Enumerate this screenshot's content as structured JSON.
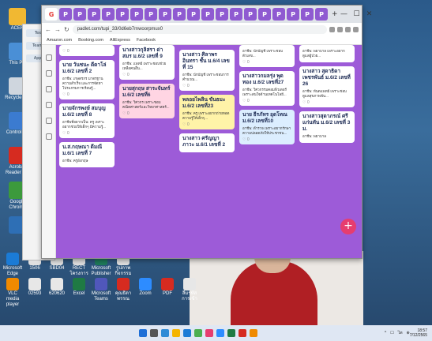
{
  "desktop": {
    "icons_left": [
      {
        "label": "ACER",
        "color": "#f1b832"
      },
      {
        "label": "This PC",
        "color": "#4a8fd6"
      },
      {
        "label": "Recycle Bin",
        "color": "#cfd6de"
      },
      {
        "label": "Control Pa",
        "color": "#3b7bd0"
      },
      {
        "label": "Acrobat Reader DC",
        "color": "#d62b20"
      },
      {
        "label": "Google Chrome",
        "color": "#3c9a3c"
      },
      {
        "label": "",
        "color": "#2e6fb5"
      }
    ],
    "icons_bottom": [
      {
        "label": "Microsoft Edge",
        "color": "#1b7bd6"
      },
      {
        "label": "1506",
        "color": "#e0e0e0"
      },
      {
        "label": "SBD04",
        "color": "#e0e0e0"
      },
      {
        "label": "RECT โครงการ",
        "color": "#e0e0e0"
      },
      {
        "label": "Microsoft Publisher",
        "color": "#1e7a5a"
      },
      {
        "label": "รูปภาพกิจกรรม",
        "color": "#e0e0e0"
      },
      {
        "label": "VLC media player",
        "color": "#f08a00"
      },
      {
        "label": "02593",
        "color": "#e7e7e7"
      },
      {
        "label": "620620",
        "color": "#e7e7e7"
      },
      {
        "label": "Excel",
        "color": "#1f7a43"
      },
      {
        "label": "Microsoft Teams",
        "color": "#5057bb"
      },
      {
        "label": "คุณธิดาพรรณ",
        "color": "#d62b20"
      },
      {
        "label": "Zoom",
        "color": "#2d8cff"
      },
      {
        "label": "PDF",
        "color": "#d62b20"
      },
      {
        "label": "ลืมรหัสการเข้า",
        "color": "#e7e7e7"
      }
    ]
  },
  "bgwin": {
    "items": [
      "Text",
      "Teams",
      "Apps"
    ]
  },
  "browser": {
    "tabs": [
      "G",
      "P",
      "P",
      "P",
      "P",
      "P",
      "P",
      "P",
      "P",
      "P",
      "P",
      "P",
      "P",
      "P",
      "P",
      "P",
      "P",
      "P",
      "P",
      "P"
    ],
    "url": "padlet.com/tupi_33/0d6eb7mwoorpmux0",
    "bookmarks": [
      "Amazon.com",
      "Booking.com",
      "AliExpress",
      "Facebook"
    ],
    "controls": [
      "—",
      "☐",
      "✕"
    ]
  },
  "padlet": {
    "columns": [
      {
        "cards": [
          {
            "title": "",
            "body": "",
            "meta": "♡ 0",
            "color": "white"
          },
          {
            "title": "นาย วันชนะ ดีดาโล่ ม.6/2 เลขที่ 2",
            "body": "อาชีพ: เกษตรกร มาตรฐานความสำเร็จ และการจัดหาโปรแกรมการเรียนรู้...",
            "meta": "♡ 0",
            "color": "white"
          },
          {
            "title": "นายจักรพงษ์ สมบุญ ม.6/2 เลขที่ 8",
            "body": "อาชีพที่อยากเป็น: ครู เพราะอยากช่วยให้เด็กๆ มีความรู้...",
            "meta": "♡ 0",
            "color": "white"
          },
          {
            "title": "น.ส.กฤษณา ดีมณี ม.6/1 เลขที่ 7",
            "body": "อาชีพ: ครูอังกฤษ",
            "meta": "",
            "color": "white"
          }
        ]
      },
      {
        "cards": [
          {
            "title": "นางสาวกุลิสรา ด่าสมร ม.6/2 เลขที่ 9",
            "body": "อาชีพ: แพทย์ เพราะชอบช่วยเหลือคนอื่น...",
            "meta": "♡ 0",
            "color": "white"
          },
          {
            "title": "นายสุกฤษ สาระจันทร์ ม.6/2 เลขที่6",
            "body": "อาชีพ: วิศวกร เพราะชอบคณิตศาสตร์และวิทยาศาสตร์...",
            "meta": "♡ 0",
            "color": "pink"
          }
        ]
      },
      {
        "cards": [
          {
            "title": "นางสาว ศิลาพร อินทรา ชั้น ม.6/4 เลขที่ 15",
            "body": "อาชีพ: นักบัญชี เพราะชอบการคำนวณ...",
            "meta": "♡ 0",
            "color": "white"
          },
          {
            "title": "พลอยไพลิน ขันธมะ ม.6/2 เลขที่23",
            "body": "อาชีพ: ครู เพราะอยากถ่ายทอดความรู้ให้เด็กๆ...",
            "meta": "♡ 0",
            "color": "yellow"
          },
          {
            "title": "นางสาว ศรัญญา ภาวะ ม.6/1 เลขที่ 2",
            "body": "",
            "meta": "",
            "color": "white"
          }
        ]
      },
      {
        "cards": [
          {
            "title": "",
            "body": "อาชีพ: นักบัญชี เพราะชอบตัวเลข...",
            "meta": "♡ 0",
            "color": "white"
          },
          {
            "title": "นางสาวกมลรุ่ง พุดทอง ม.6/2 เลขที่27",
            "body": "อาชีพ: วิศวกรรมคอมพิวเตอร์ เพราะสนใจด้านเทคโนโลยี...",
            "meta": "♡ 0",
            "color": "white"
          },
          {
            "title": "นาย ธีรภัทร อุดโทณ ม.6/2 เลขที่10",
            "body": "อาชีพ: ตำรวจ เพราะอยากรักษาความปลอดภัยให้ประชาชน...",
            "meta": "♡ 0",
            "color": "blue"
          }
        ]
      },
      {
        "cards": [
          {
            "title": "",
            "body": "อาชีพ: พยาบาล เพราะอยากดูแลผู้ป่วย...",
            "meta": "",
            "color": "white"
          },
          {
            "title": "นางสาว สุดาธิดา เพชรพันธ์ ม.6/2 เลขที่ 26",
            "body": "อาชีพ: ทันตแพทย์ เพราะชอบดูแลสุขภาพฟัน...",
            "meta": "♡ 0",
            "color": "white"
          },
          {
            "title": "นางสาวสุดาภรณ์ ศรีแก่นทัน ม.6/2 เลขที่ 3 ม.",
            "body": "อาชีพ: พยาบาล",
            "meta": "",
            "color": "white"
          }
        ]
      }
    ]
  },
  "taskbar": {
    "icon_colors": [
      "#1e6fd6",
      "#555",
      "#2e8bd6",
      "#f4b400",
      "#1b7bd6",
      "#4caf50",
      "#e63d6f",
      "#2d8cff",
      "#1f7a43",
      "#d62b20",
      "#f08a00"
    ],
    "tray": [
      "^",
      "☐",
      "ไท",
      "⊕"
    ],
    "time": "18:57",
    "date": "7/12/2565"
  }
}
